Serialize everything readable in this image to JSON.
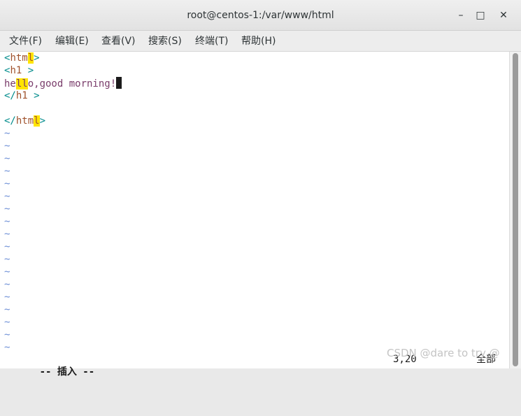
{
  "window": {
    "title": "root@centos-1:/var/www/html",
    "minimize_glyph": "–",
    "maximize_glyph": "□",
    "close_glyph": "✕"
  },
  "menu": [
    "文件(F)",
    "编辑(E)",
    "查看(V)",
    "搜索(S)",
    "终端(T)",
    "帮助(H)"
  ],
  "editor": {
    "line1": {
      "open": "<",
      "name_a": "htm",
      "name_hl": "l",
      "close": ">"
    },
    "line2": {
      "open": "<",
      "name": "h1",
      "close": " >"
    },
    "line3": {
      "a": "he",
      "hl": "ll",
      "b": "o,good morning!"
    },
    "line4": {
      "open": "</",
      "name": "h1",
      "close": " >"
    },
    "line6": {
      "open": "</",
      "name_a": "htm",
      "name_hl": "l",
      "close": ">"
    },
    "tilde": "~"
  },
  "status": {
    "mode": "-- 插入 --",
    "position": "3,20",
    "percent": "全部"
  },
  "watermark": "CSDN @dare to try @",
  "colors": {
    "tag": "#008b8b",
    "tag_name": "#a0522d",
    "text": "#7a3d6b",
    "match_highlight": "#ffe400",
    "tilde": "#6d8fd6"
  }
}
